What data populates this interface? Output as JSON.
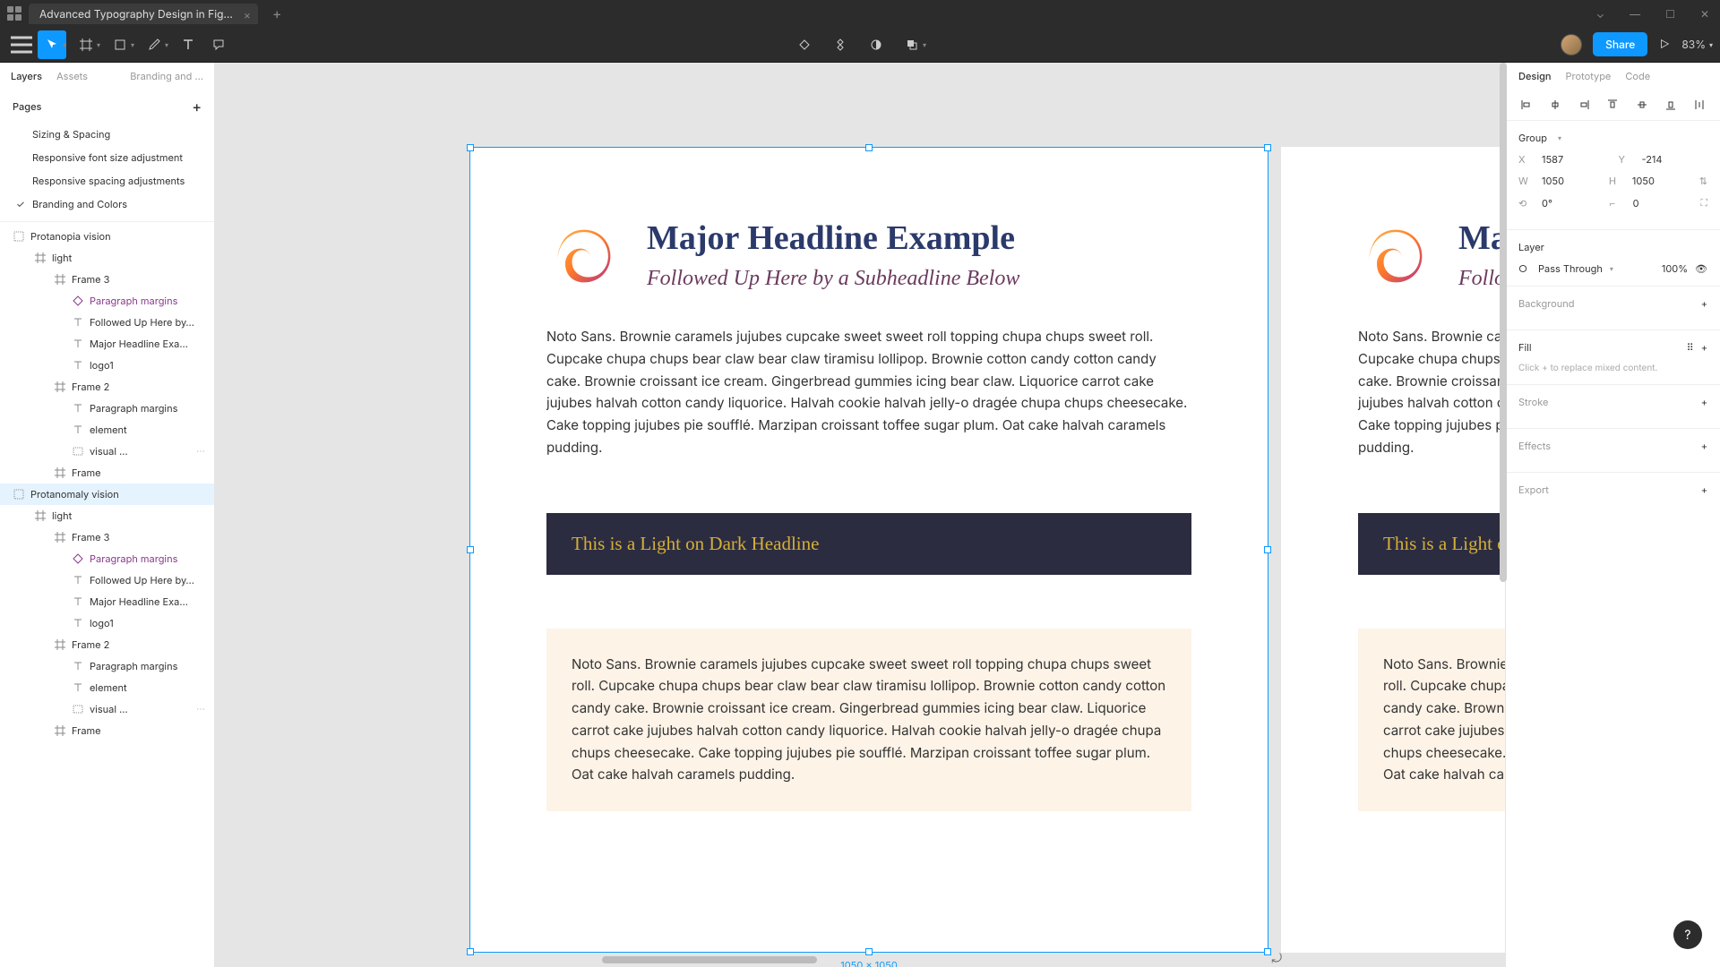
{
  "titlebar": {
    "tab_title": "Advanced Typography Design in Fig…"
  },
  "toolbar": {
    "share_label": "Share",
    "zoom": "83%"
  },
  "leftPanel": {
    "tabs": [
      "Layers",
      "Assets",
      "Branding and …"
    ],
    "pages_label": "Pages",
    "pages": [
      "Sizing & Spacing",
      "Responsive font size adjustment",
      "Responsive spacing adjustments",
      "Branding and Colors"
    ],
    "layers": [
      {
        "label": "Protanopia vision",
        "indent": 0,
        "icon": "group"
      },
      {
        "label": "light",
        "indent": 1,
        "icon": "frame"
      },
      {
        "label": "Frame 3",
        "indent": 2,
        "icon": "frame"
      },
      {
        "label": "Paragraph margins",
        "indent": 3,
        "icon": "diamond",
        "purple": true
      },
      {
        "label": "Followed Up Here by…",
        "indent": 3,
        "icon": "text"
      },
      {
        "label": "Major Headline Exa…",
        "indent": 3,
        "icon": "text"
      },
      {
        "label": "logo1",
        "indent": 3,
        "icon": "text"
      },
      {
        "label": "Frame 2",
        "indent": 2,
        "icon": "frame"
      },
      {
        "label": "Paragraph margins",
        "indent": 3,
        "icon": "text"
      },
      {
        "label": "element",
        "indent": 3,
        "icon": "text"
      },
      {
        "label": "visual …",
        "indent": 3,
        "icon": "img",
        "actions": true
      },
      {
        "label": "Frame",
        "indent": 2,
        "icon": "frame"
      },
      {
        "label": "Protanomaly vision",
        "indent": 0,
        "icon": "group",
        "selected": true
      },
      {
        "label": "light",
        "indent": 1,
        "icon": "frame"
      },
      {
        "label": "Frame 3",
        "indent": 2,
        "icon": "frame"
      },
      {
        "label": "Paragraph margins",
        "indent": 3,
        "icon": "diamond",
        "purple": true
      },
      {
        "label": "Followed Up Here by…",
        "indent": 3,
        "icon": "text"
      },
      {
        "label": "Major Headline Exa…",
        "indent": 3,
        "icon": "text"
      },
      {
        "label": "logo1",
        "indent": 3,
        "icon": "text"
      },
      {
        "label": "Frame 2",
        "indent": 2,
        "icon": "frame"
      },
      {
        "label": "Paragraph margins",
        "indent": 3,
        "icon": "text"
      },
      {
        "label": "element",
        "indent": 3,
        "icon": "text"
      },
      {
        "label": "visual …",
        "indent": 3,
        "icon": "img",
        "actions": true
      },
      {
        "label": "Frame",
        "indent": 2,
        "icon": "frame"
      }
    ]
  },
  "canvas": {
    "dimensions": "1050 × 1050",
    "headline": "Major Headline Example",
    "subheadline": "Followed Up Here by a Subheadline Below",
    "body": "Noto Sans. Brownie caramels jujubes cupcake sweet sweet roll topping chupa chups sweet roll. Cupcake chupa chups bear claw bear claw tiramisu lollipop. Brownie cotton candy cotton candy cake. Brownie croissant ice cream. Gingerbread gummies icing bear claw. Liquorice carrot cake jujubes halvah cotton candy liquorice. Halvah cookie halvah jelly-o dragée chupa chups cheesecake. Cake topping jujubes pie soufflé. Marzipan croissant toffee sugar plum. Oat cake halvah caramels pudding.",
    "dark_headline": "This is a Light on Dark Headline",
    "beige_body": "Noto Sans. Brownie caramels jujubes cupcake sweet sweet roll topping chupa chups sweet roll. Cupcake chupa chups bear claw bear claw tiramisu lollipop. Brownie cotton candy cotton candy cake. Brownie croissant ice cream. Gingerbread gummies icing bear claw. Liquorice carrot cake jujubes halvah cotton candy liquorice. Halvah cookie halvah jelly-o dragée chupa chups cheesecake. Cake topping jujubes pie soufflé. Marzipan croissant toffee sugar plum. Oat cake halvah caramels pudding."
  },
  "rightPanel": {
    "tabs": [
      "Design",
      "Prototype",
      "Code"
    ],
    "frame_type": "Group",
    "x_label": "X",
    "x": "1587",
    "y_label": "Y",
    "y": "-214",
    "w_label": "W",
    "w": "1050",
    "h_label": "H",
    "h": "1050",
    "rot_label": "",
    "rot": "0°",
    "corner_label": "",
    "corner": "0",
    "layer_label": "Layer",
    "blend": "Pass Through",
    "opacity": "100%",
    "background_label": "Background",
    "fill_label": "Fill",
    "fill_hint": "Click + to replace mixed content.",
    "stroke_label": "Stroke",
    "effects_label": "Effects",
    "export_label": "Export"
  },
  "help": "?"
}
